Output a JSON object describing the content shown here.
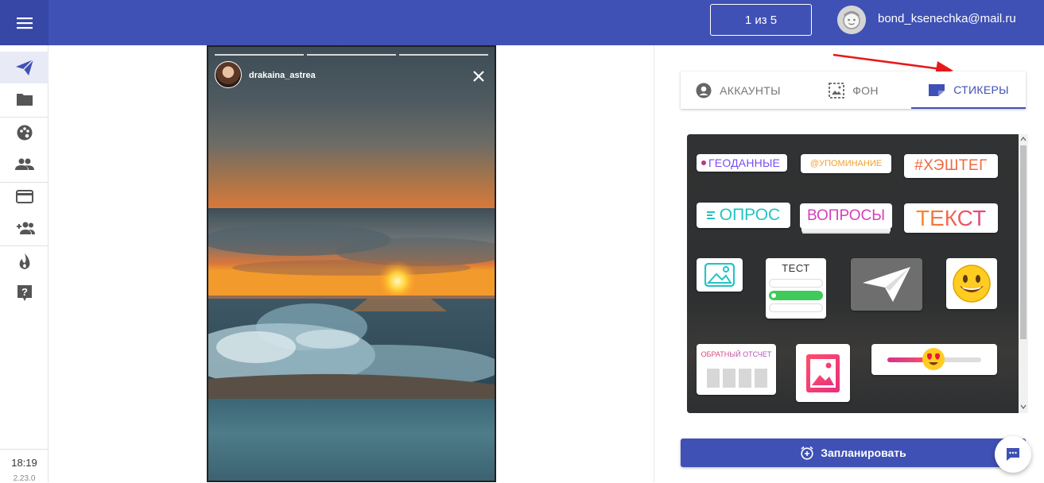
{
  "header": {
    "menu_icon": "hamburger-menu-icon",
    "counter": "1 из 5",
    "user_email": "bond_ksenechka@mail.ru",
    "avatar_icon": "user-avatar-icon",
    "accent_color": "#3f51b5"
  },
  "sidebar": {
    "items": [
      {
        "icon": "send-icon",
        "active": true
      },
      {
        "icon": "folder-icon",
        "active": false
      },
      {
        "icon": "palette-icon",
        "active": false
      },
      {
        "icon": "people-icon",
        "active": false
      },
      {
        "icon": "credit-card-icon",
        "active": false
      },
      {
        "icon": "add-person-icon",
        "active": false
      },
      {
        "icon": "fire-icon",
        "active": false
      },
      {
        "icon": "help-icon",
        "active": false
      }
    ],
    "time": "18:19",
    "version": "2.23.0"
  },
  "story": {
    "username": "drakaina_astrea",
    "segments_total": 3,
    "segments_filled": 3,
    "close_icon": "close-icon"
  },
  "tabs": [
    {
      "label": "АККАУНТЫ",
      "icon": "account-circle-icon",
      "active": false
    },
    {
      "label": "ФОН",
      "icon": "image-background-icon",
      "active": false
    },
    {
      "label": "СТИКЕРЫ",
      "icon": "sticker-icon",
      "active": true
    }
  ],
  "stickers": {
    "geodata": "ГЕОДАННЫЕ",
    "mention": "@УПОМИНАНИЕ",
    "hashtag": "#ХЭШТЕГ",
    "poll": "ОПРОС",
    "questions": "ВОПРОСЫ",
    "text": "ТЕКСТ",
    "quiz": "ТЕСТ",
    "countdown": "ОБРАТНЫЙ ОТСЧЕТ",
    "image_icon": "image-icon",
    "send_icon": "paper-plane-icon",
    "emoji_icon": "smiley-emoji-icon",
    "gallery_icon": "gallery-image-icon",
    "slider_icon": "heart-eyes-slider-icon"
  },
  "schedule_button": {
    "label": "Запланировать",
    "icon": "alarm-add-icon"
  },
  "chat_button": {
    "icon": "chat-icon"
  }
}
